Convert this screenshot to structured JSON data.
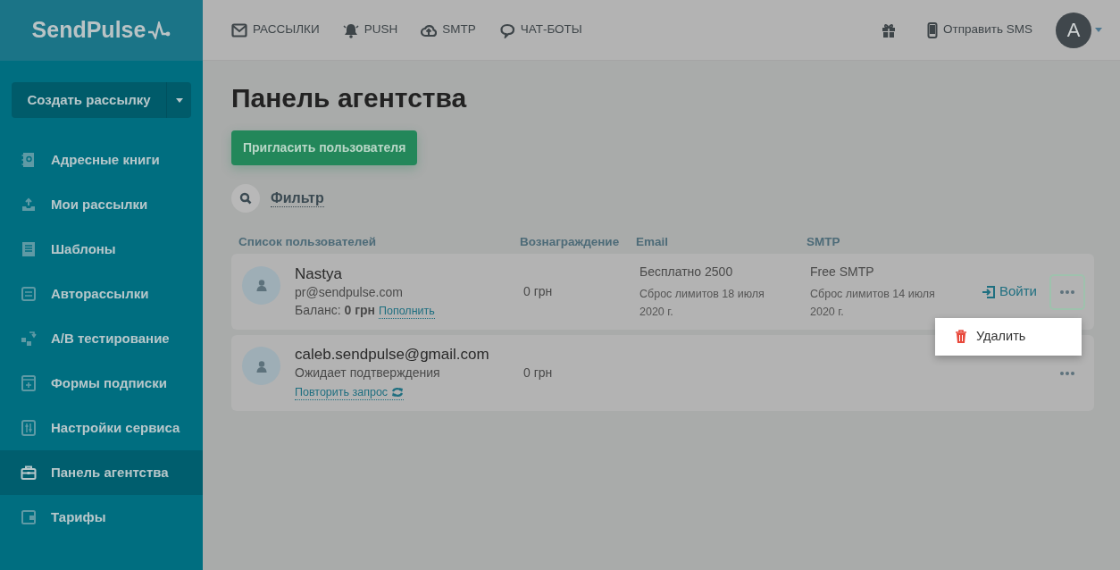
{
  "logo": {
    "text": "SendPulse"
  },
  "top_nav": [
    {
      "label": "РАССЫЛКИ"
    },
    {
      "label": "PUSH"
    },
    {
      "label": "SMTP"
    },
    {
      "label": "ЧАТ-БОТЫ"
    }
  ],
  "send_sms": "Отправить SMS",
  "avatar": {
    "letter": "A"
  },
  "sidebar": {
    "create_button": "Создать рассылку",
    "items": [
      {
        "label": "Адресные книги",
        "selected": false
      },
      {
        "label": "Мои рассылки",
        "selected": false
      },
      {
        "label": "Шаблоны",
        "selected": false
      },
      {
        "label": "Авторассылки",
        "selected": false
      },
      {
        "label": "A/B тестирование",
        "selected": false
      },
      {
        "label": "Формы подписки",
        "selected": false
      },
      {
        "label": "Настройки сервиса",
        "selected": false
      },
      {
        "label": "Панель агентства",
        "selected": true
      },
      {
        "label": "Тарифы",
        "selected": false
      }
    ]
  },
  "page": {
    "title": "Панель агентства",
    "invite_button": "Пригласить пользователя",
    "filter": "Фильтр"
  },
  "table": {
    "columns": [
      "Список пользователей",
      "Вознаграждение",
      "Email",
      "SMTP"
    ],
    "rows": [
      {
        "kind": "active",
        "name": "Nastya",
        "email": "pr@sendpulse.com",
        "balance": "Баланс: **0 грн**",
        "top_up": "Пополнить",
        "reward": "0 грн",
        "email_plan": "Бесплатно 2500",
        "email_reset": "Сброс лимитов 18 июля 2020 г.",
        "smtp_plan": "Free SMTP",
        "smtp_reset": "Сброс лимитов 14 июля 2020 г.",
        "login": "Войти",
        "expanded": true
      },
      {
        "kind": "pending",
        "name": "caleb.sendpulse@gmail.com",
        "status": "Ожидает подтверждения",
        "retry": "Повторить запрос",
        "reward": "0 грн",
        "expanded": false
      }
    ]
  },
  "row_menu": {
    "items": [
      {
        "label": "Удалить"
      }
    ]
  }
}
